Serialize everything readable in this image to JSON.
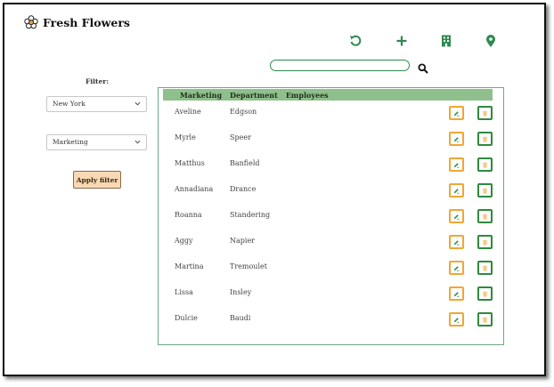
{
  "app": {
    "title": "Fresh Flowers",
    "logo_icon": "flower-icon"
  },
  "toolbar": {
    "icons": [
      "undo-icon",
      "plus-icon",
      "building-icon",
      "location-pin-icon"
    ],
    "accent_color": "#2f8a50"
  },
  "search": {
    "value": "",
    "placeholder": "",
    "icon": "search-icon"
  },
  "filter": {
    "label": "Filter:",
    "city": "New York",
    "department": "Marketing",
    "apply_label": "Apply filter"
  },
  "table": {
    "columns": [
      "Marketing",
      "Department",
      "Employees"
    ],
    "rows": [
      {
        "first": "Aveline",
        "last": "Edgson"
      },
      {
        "first": "Myrle",
        "last": "Speer"
      },
      {
        "first": "Matthus",
        "last": "Banfield"
      },
      {
        "first": "Annadiana",
        "last": "Drance"
      },
      {
        "first": "Roanna",
        "last": "Standering"
      },
      {
        "first": "Aggy",
        "last": "Napier"
      },
      {
        "first": "Martina",
        "last": "Tremoulet"
      },
      {
        "first": "Lissa",
        "last": "Insley"
      },
      {
        "first": "Dulcie",
        "last": "Baudi"
      }
    ],
    "header_color": "#8fbf8c",
    "edit_color": "#f0a636",
    "delete_color": "#2f8a3c"
  }
}
